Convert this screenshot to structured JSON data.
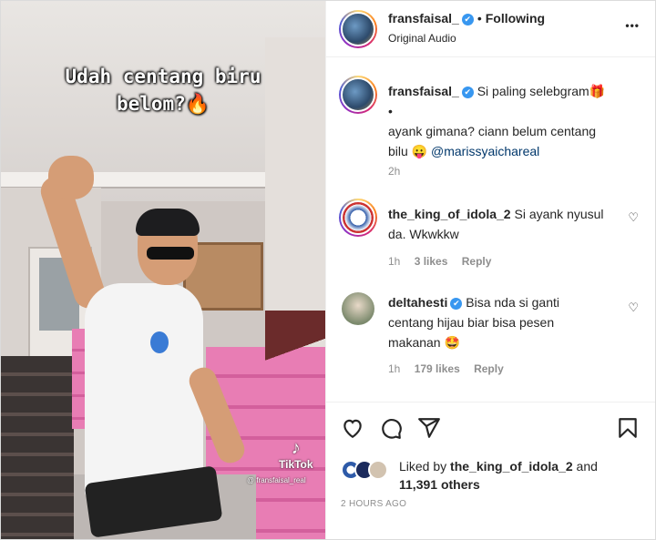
{
  "media": {
    "overlay_line1": "Udah centang biru",
    "overlay_line2": "belom?🔥",
    "watermark": "TikTok",
    "watermark_user": "@ fransfaisal_real"
  },
  "header": {
    "username": "fransfaisal_",
    "verified_icon": "✔",
    "separator": "•",
    "follow_status": "Following",
    "audio": "Original Audio",
    "more_icon": "•••"
  },
  "post": {
    "username": "fransfaisal_",
    "verified_icon": "✔",
    "line1": "Si paling selebgram🎁",
    "bullet": "•",
    "line2": "ayank gimana? ciann belum centang",
    "line3_text": "bilu 😛",
    "mention": "@marissyaichareal",
    "time": "2h"
  },
  "comments": [
    {
      "username": "the_king_of_idola_2",
      "text_line1": "Si ayank nyusul",
      "text_line2": "da. Wkwkkw",
      "time": "1h",
      "likes": "3 likes",
      "reply": "Reply",
      "heart_icon": "♡"
    },
    {
      "username": "deltahesti",
      "verified_icon": "✔",
      "text_line1": "Bisa nda si ganti",
      "text_line2": "centang hijau biar bisa pesen",
      "text_line3": "makanan 🤩",
      "time": "1h",
      "likes": "179 likes",
      "reply": "Reply",
      "heart_icon": "♡"
    }
  ],
  "actions": {
    "like_icon": "heart-icon",
    "comment_icon": "comment-icon",
    "share_icon": "share-icon",
    "save_icon": "bookmark-icon"
  },
  "likes": {
    "prefix": "Liked by",
    "user": "the_king_of_idola_2",
    "and": "and",
    "count": "11,391 others"
  },
  "timestamp": "2 HOURS AGO",
  "colors": {
    "verified": "#3897f0",
    "link": "#00376b",
    "muted": "#8e8e8e",
    "text": "#262626"
  }
}
